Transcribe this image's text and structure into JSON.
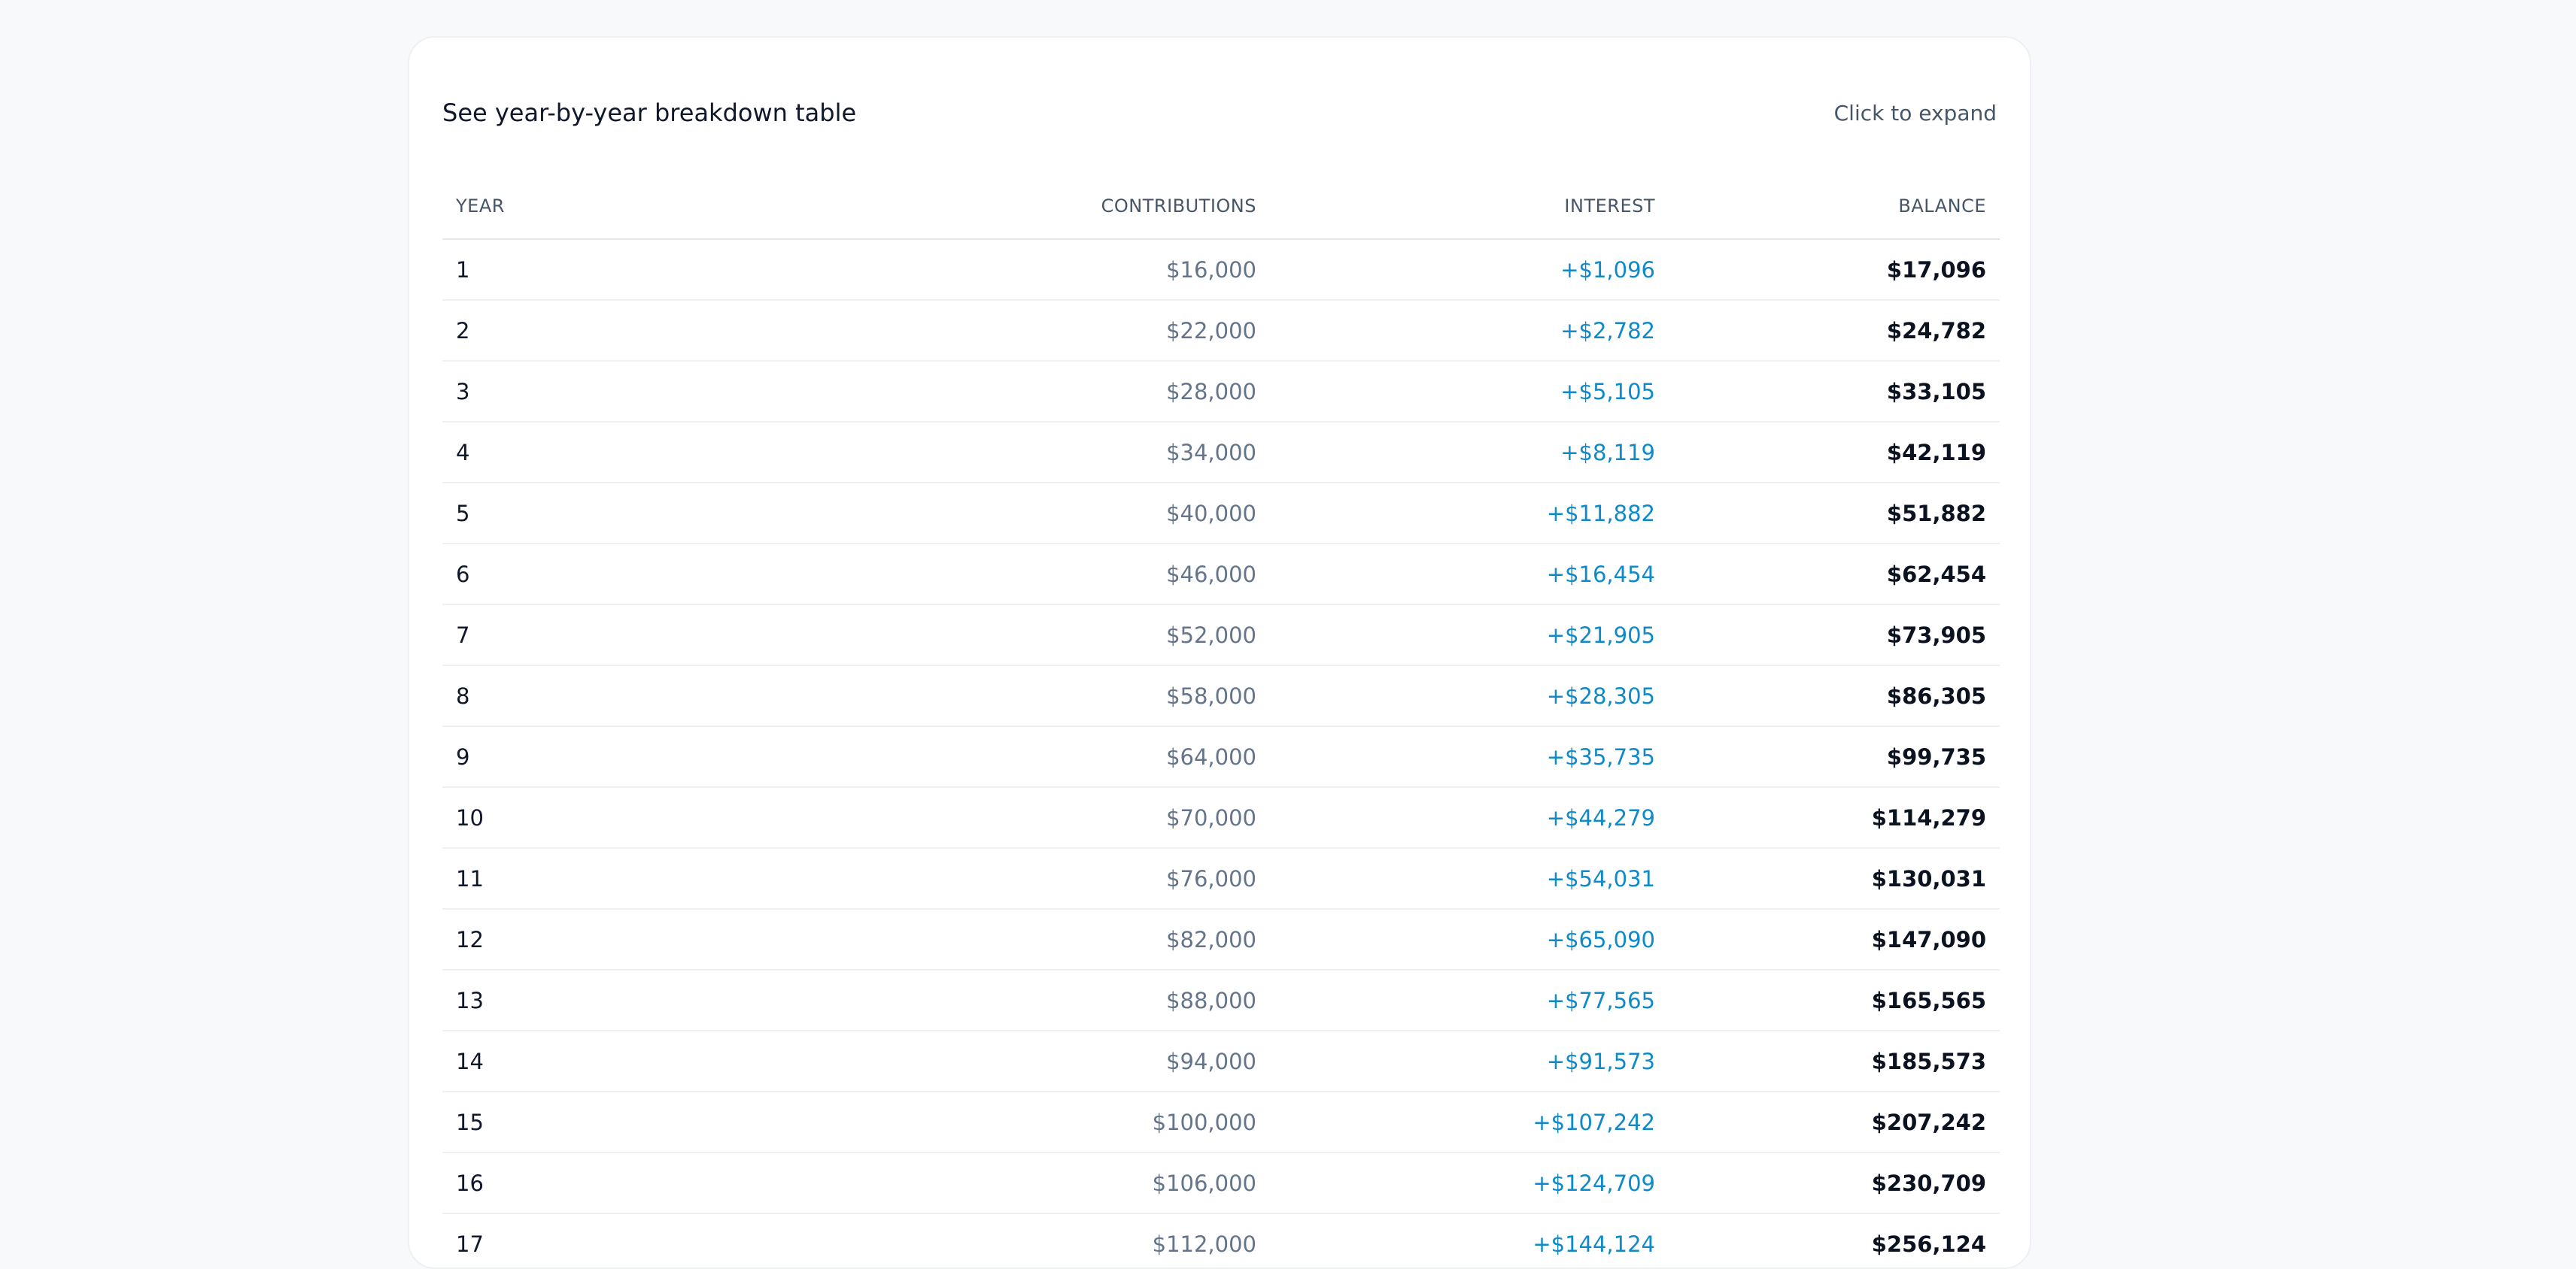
{
  "breakdown": {
    "title": "See year-by-year breakdown table",
    "expand_label": "Click to expand",
    "columns": {
      "year": "YEAR",
      "contributions": "CONTRIBUTIONS",
      "interest": "INTEREST",
      "balance": "BALANCE"
    },
    "rows": [
      {
        "year": "1",
        "contributions": "$16,000",
        "interest": "+$1,096",
        "balance": "$17,096"
      },
      {
        "year": "2",
        "contributions": "$22,000",
        "interest": "+$2,782",
        "balance": "$24,782"
      },
      {
        "year": "3",
        "contributions": "$28,000",
        "interest": "+$5,105",
        "balance": "$33,105"
      },
      {
        "year": "4",
        "contributions": "$34,000",
        "interest": "+$8,119",
        "balance": "$42,119"
      },
      {
        "year": "5",
        "contributions": "$40,000",
        "interest": "+$11,882",
        "balance": "$51,882"
      },
      {
        "year": "6",
        "contributions": "$46,000",
        "interest": "+$16,454",
        "balance": "$62,454"
      },
      {
        "year": "7",
        "contributions": "$52,000",
        "interest": "+$21,905",
        "balance": "$73,905"
      },
      {
        "year": "8",
        "contributions": "$58,000",
        "interest": "+$28,305",
        "balance": "$86,305"
      },
      {
        "year": "9",
        "contributions": "$64,000",
        "interest": "+$35,735",
        "balance": "$99,735"
      },
      {
        "year": "10",
        "contributions": "$70,000",
        "interest": "+$44,279",
        "balance": "$114,279"
      },
      {
        "year": "11",
        "contributions": "$76,000",
        "interest": "+$54,031",
        "balance": "$130,031"
      },
      {
        "year": "12",
        "contributions": "$82,000",
        "interest": "+$65,090",
        "balance": "$147,090"
      },
      {
        "year": "13",
        "contributions": "$88,000",
        "interest": "+$77,565",
        "balance": "$165,565"
      },
      {
        "year": "14",
        "contributions": "$94,000",
        "interest": "+$91,573",
        "balance": "$185,573"
      },
      {
        "year": "15",
        "contributions": "$100,000",
        "interest": "+$107,242",
        "balance": "$207,242"
      },
      {
        "year": "16",
        "contributions": "$106,000",
        "interest": "+$124,709",
        "balance": "$230,709"
      },
      {
        "year": "17",
        "contributions": "$112,000",
        "interest": "+$144,124",
        "balance": "$256,124"
      }
    ]
  },
  "colors": {
    "page_background": "#f8f9fb",
    "card_background": "#ffffff",
    "interest_accent": "#0e8ac9",
    "heading_text": "#0f172a",
    "muted_text": "#64748b"
  }
}
